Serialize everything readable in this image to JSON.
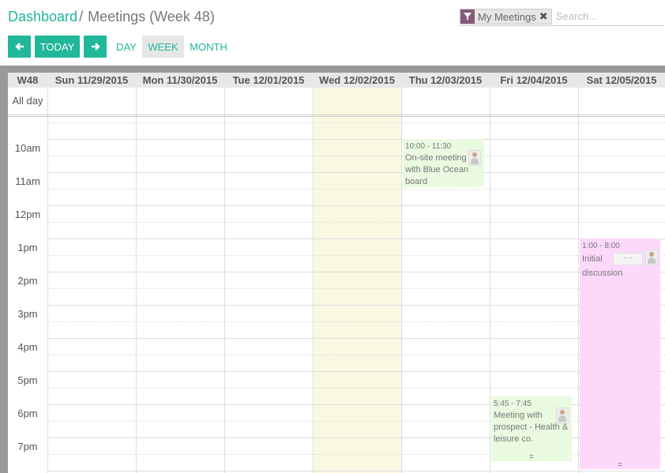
{
  "breadcrumb": {
    "parent": "Dashboard",
    "separator": "/",
    "current": "Meetings (Week 48)"
  },
  "search": {
    "facet_icon": "filter-icon",
    "facet_label": "My Meetings",
    "facet_close": "✖",
    "placeholder": "Search..."
  },
  "toolbar": {
    "prev_glyph": "🡐",
    "today_label": "TODAY",
    "next_glyph": "🡒",
    "modes": {
      "day": "DAY",
      "week": "WEEK",
      "month": "MONTH"
    },
    "active_mode": "week"
  },
  "calendar": {
    "week_label": "W48",
    "allday_label": "All day",
    "days": [
      "Sun 11/29/2015",
      "Mon 11/30/2015",
      "Tue 12/01/2015",
      "Wed 12/02/2015",
      "Thu 12/03/2015",
      "Fri 12/04/2015",
      "Sat 12/05/2015"
    ],
    "today_column": "Wed 12/02/2015",
    "hours": [
      "10am",
      "11am",
      "12pm",
      "1pm",
      "2pm",
      "3pm",
      "4pm",
      "5pm",
      "6pm",
      "7pm"
    ],
    "colors": {
      "accent": "#21b799",
      "today_bg": "#fbf8e2",
      "facet_icon_bg": "#875a7b"
    }
  },
  "events": [
    {
      "time": "10:00 - 11:30",
      "title": "On-site meeting with Blue Ocean board",
      "color": "#eafae0"
    },
    {
      "time": "1:00 - 8:00",
      "title": "Initial discussion",
      "color": "#fcd9fa"
    },
    {
      "time": "5:45 - 7:45",
      "title": "Meeting with prospect - Health & leisure co.",
      "color": "#eafae0"
    }
  ]
}
